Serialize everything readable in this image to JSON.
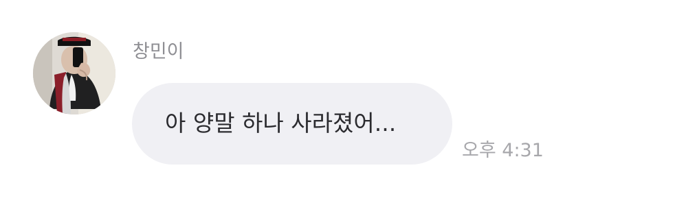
{
  "message": {
    "sender_name": "창민이",
    "text": "아 양말 하나 사라졌어...",
    "timestamp": "오후 4:31",
    "avatar_icon": "profile-photo-icon"
  },
  "colors": {
    "bubble": "#f0f0f4",
    "name_text": "#8e8e93",
    "message_text": "#2b2b2f",
    "timestamp_text": "#a7a7ab"
  }
}
